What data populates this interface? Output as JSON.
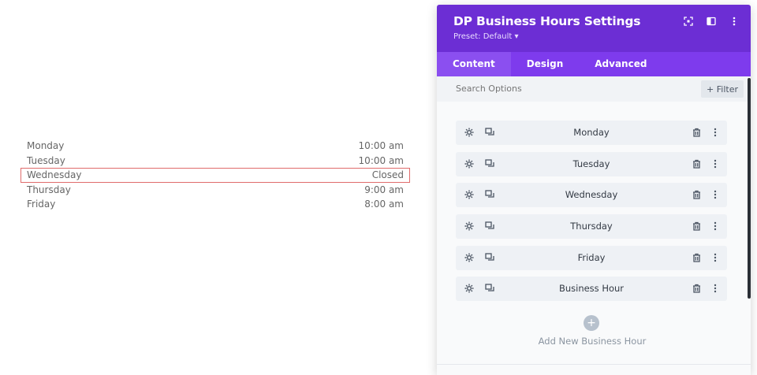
{
  "preview": {
    "rows": [
      {
        "day": "Monday",
        "time": "10:00 am",
        "highlighted": false
      },
      {
        "day": "Tuesday",
        "time": "10:00 am",
        "highlighted": false
      },
      {
        "day": "Wednesday",
        "time": "Closed",
        "highlighted": true
      },
      {
        "day": "Thursday",
        "time": "9:00 am",
        "highlighted": false
      },
      {
        "day": "Friday",
        "time": "8:00 am",
        "highlighted": false
      }
    ]
  },
  "panel": {
    "title": "DP Business Hours Settings",
    "preset": "Preset: Default ▾",
    "header_icons": [
      "expand-icon",
      "sidebar-toggle-icon",
      "more-vertical-icon"
    ],
    "tabs": [
      {
        "label": "Content",
        "active": true
      },
      {
        "label": "Design",
        "active": false
      },
      {
        "label": "Advanced",
        "active": false
      }
    ],
    "search_placeholder": "Search Options",
    "filter_label": "+ Filter",
    "items": [
      {
        "label": "Monday"
      },
      {
        "label": "Tuesday"
      },
      {
        "label": "Wednesday"
      },
      {
        "label": "Thursday"
      },
      {
        "label": "Friday"
      },
      {
        "label": "Business Hour"
      }
    ],
    "add_label": "Add New Business Hour",
    "add_symbol": "+"
  },
  "colors": {
    "header": "#6c2ed4",
    "tabs": "#7e3bed",
    "active_tab": "#8b4ff0",
    "highlight_border": "#e06b6b"
  }
}
